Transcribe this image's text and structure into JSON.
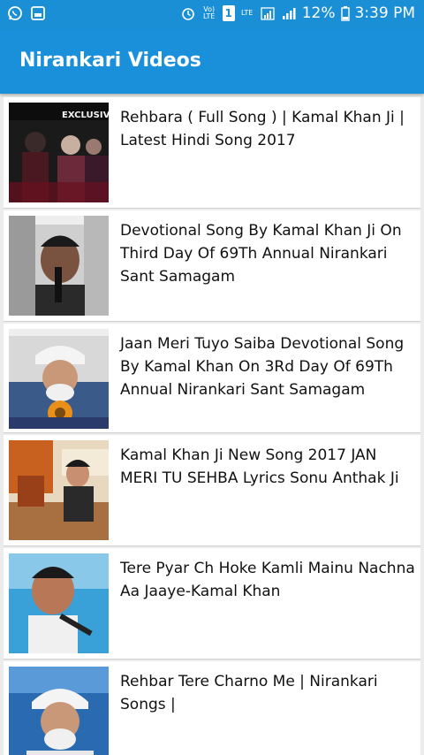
{
  "status_bar": {
    "volte": "Vo) LTE",
    "lte": "LTE",
    "sim": "1",
    "battery": "12%",
    "time": "3:39 PM"
  },
  "app_bar": {
    "title": "Nirankari Videos"
  },
  "videos": [
    {
      "title": "Rehbara ( Full Song ) | Kamal Khan Ji | Latest Hindi Song 2017",
      "thumb_text": "EXCLUSIVE"
    },
    {
      "title": "Devotional Song By Kamal Khan Ji On Third Day Of 69Th Annual Nirankari Sant Samagam"
    },
    {
      "title": "Jaan Meri Tuyo Saiba Devotional Song By Kamal Khan On 3Rd Day Of 69Th Annual Nirankari Sant Samagam"
    },
    {
      "title": "Kamal Khan Ji New Song 2017 JAN MERI TU SEHBA Lyrics Sonu Anthak Ji"
    },
    {
      "title": "Tere Pyar Ch Hoke Kamli Mainu Nachna Aa Jaaye-Kamal Khan"
    },
    {
      "title": "Rehbar Tere Charno Me | Nirankari Songs |"
    }
  ]
}
